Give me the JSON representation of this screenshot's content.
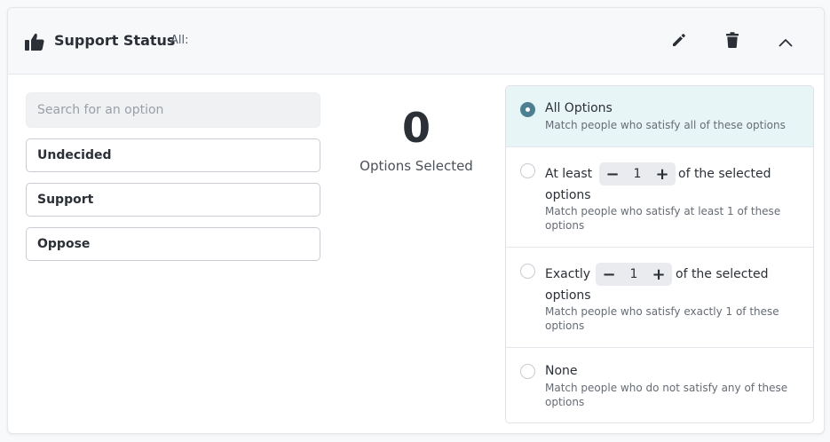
{
  "header": {
    "title": "Support Status",
    "subtitle": "All:",
    "icons": {
      "leading": "thumbs-up-icon",
      "edit": "pencil-icon",
      "delete": "trash-icon",
      "collapse": "chevron-up-icon"
    }
  },
  "search": {
    "placeholder": "Search for an option",
    "value": ""
  },
  "options": [
    "Undecided",
    "Support",
    "Oppose"
  ],
  "selection": {
    "count": "0",
    "label": "Options Selected"
  },
  "match_modes": {
    "selected": "all",
    "all": {
      "title": "All Options",
      "description": "Match people who satisfy all of these options"
    },
    "at_least": {
      "prefix": "At least",
      "value": "1",
      "suffix": "of the selected",
      "suffix2": "options",
      "description": "Match people who satisfy at least 1 of these options"
    },
    "exactly": {
      "prefix": "Exactly",
      "value": "1",
      "suffix": "of the selected",
      "suffix2": "options",
      "description": "Match people who satisfy exactly 1 of these options"
    },
    "none": {
      "title": "None",
      "description": "Match people who do not satisfy any of these options"
    }
  },
  "colors": {
    "accent": "#4c7f91",
    "selected_bg": "#e8f5f7",
    "border": "#c9cdd3"
  }
}
